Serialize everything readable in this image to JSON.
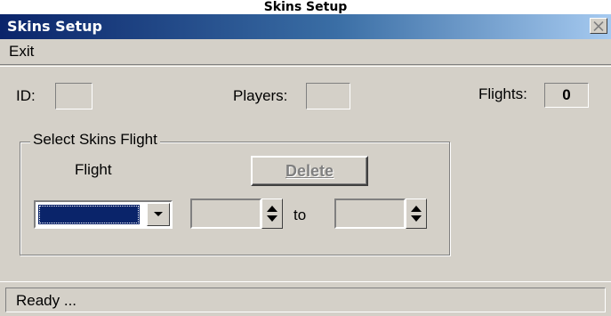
{
  "page_heading": "Skins Setup",
  "window": {
    "title": "Skins Setup",
    "close_icon": "close-x-icon"
  },
  "menu": {
    "exit_label": "Exit"
  },
  "fields": {
    "id_label": "ID:",
    "id_value": "",
    "players_label": "Players:",
    "players_value": "",
    "flights_label": "Flights:",
    "flights_value": "0"
  },
  "group": {
    "legend": "Select Skins Flight",
    "flight_label": "Flight",
    "delete_label": "Delete",
    "delete_enabled": false,
    "flight_selected": "",
    "from_value": "",
    "to_label": "to",
    "to_value": ""
  },
  "status": {
    "text": "Ready ..."
  },
  "colors": {
    "titlebar_start": "#0a246a",
    "titlebar_end": "#a6caf0",
    "face": "#d4d0c8",
    "selection": "#0a246a"
  }
}
